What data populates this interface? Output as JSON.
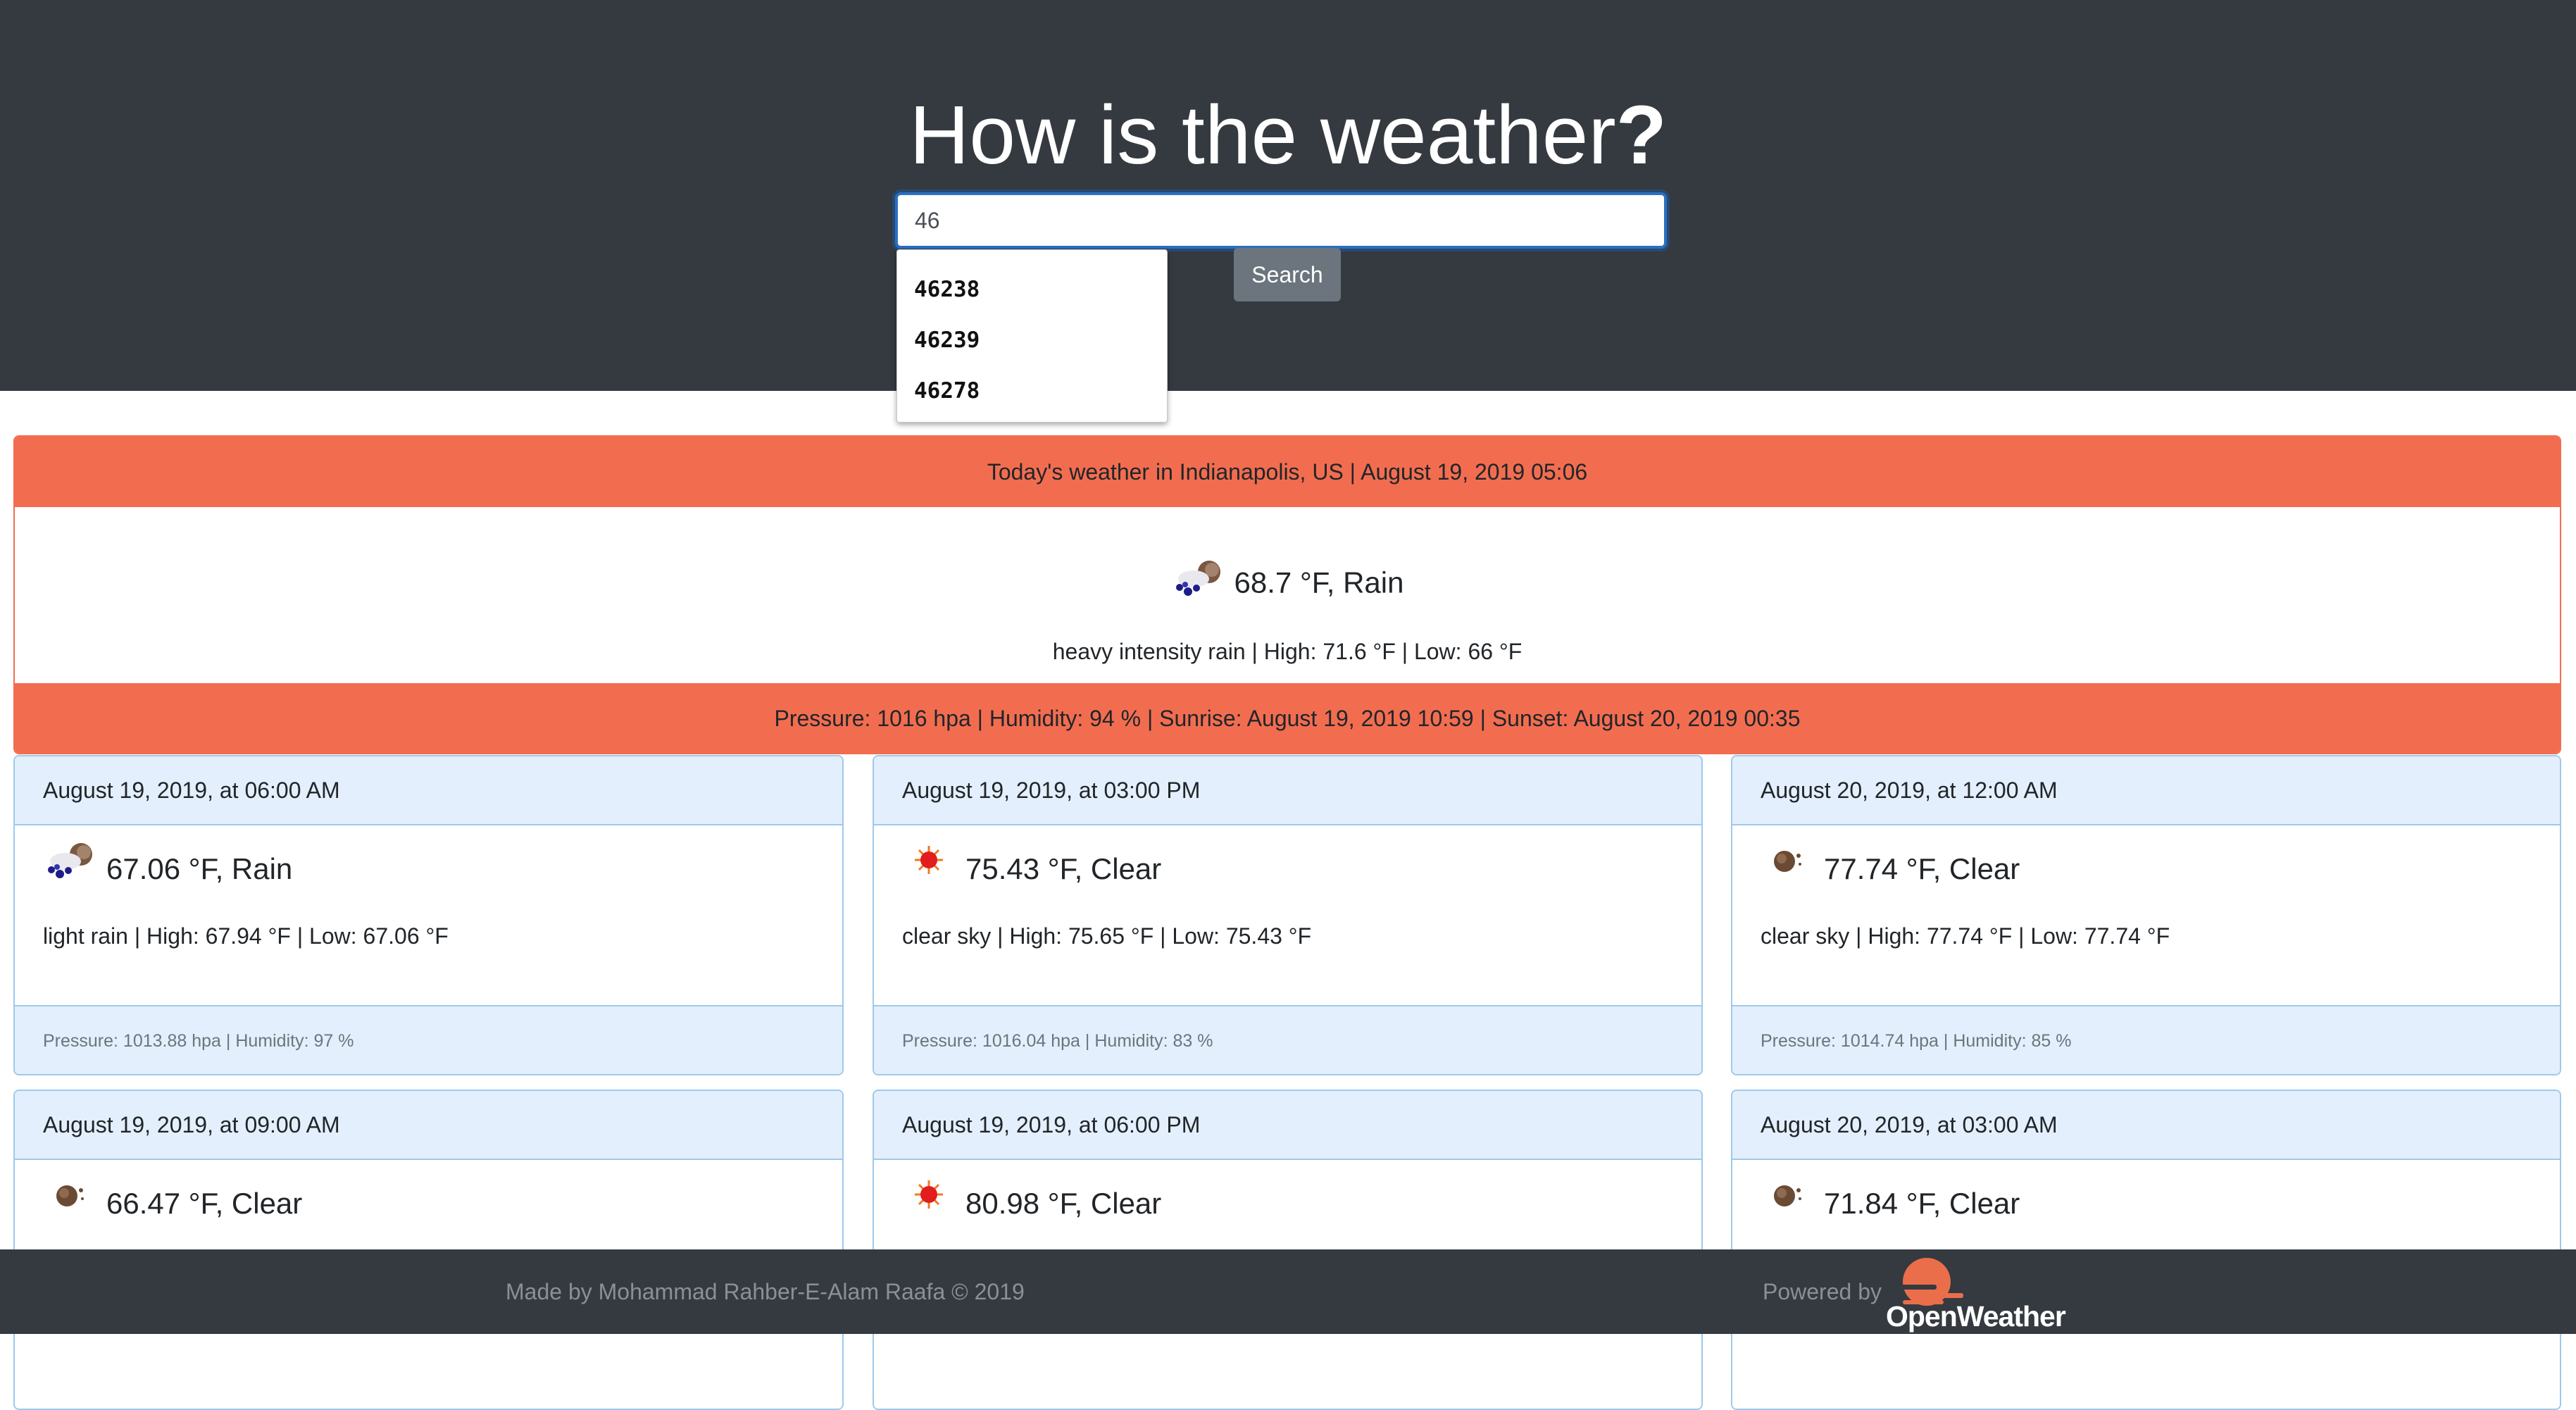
{
  "header": {
    "title": "How is the weather",
    "title_mark": "?",
    "search": {
      "value": "46",
      "button_label": "Search"
    },
    "autocomplete": [
      "46238",
      "46239",
      "46278"
    ]
  },
  "today": {
    "heading": "Today's weather in Indianapolis, US | August 19, 2019 05:06",
    "icon": "rain-cloud-icon",
    "summary": "68.7 °F, Rain",
    "detail": "heavy intensity rain | High: 71.6 °F | Low: 66 °F",
    "footer": "Pressure: 1016 hpa | Humidity: 94 % | Sunrise: August 19, 2019 10:59 | Sunset: August 20, 2019 00:35"
  },
  "forecast": [
    {
      "time": "August 19, 2019, at 06:00 AM",
      "icon": "rain-cloud-icon",
      "summary": "67.06 °F, Rain",
      "detail": "light rain | High: 67.94 °F | Low: 67.06 °F",
      "footer": "Pressure: 1013.88 hpa | Humidity: 97 %"
    },
    {
      "time": "August 19, 2019, at 03:00 PM",
      "icon": "sun-icon",
      "summary": "75.43 °F, Clear",
      "detail": "clear sky | High: 75.65 °F | Low: 75.43 °F",
      "footer": "Pressure: 1016.04 hpa | Humidity: 83 %"
    },
    {
      "time": "August 20, 2019, at 12:00 AM",
      "icon": "moon-icon",
      "summary": "77.74 °F, Clear",
      "detail": "clear sky | High: 77.74 °F | Low: 77.74 °F",
      "footer": "Pressure: 1014.74 hpa | Humidity: 85 %"
    },
    {
      "time": "August 19, 2019, at 09:00 AM",
      "icon": "moon-icon",
      "summary": "66.47 °F, Clear"
    },
    {
      "time": "August 19, 2019, at 06:00 PM",
      "icon": "sun-icon",
      "summary": "80.98 °F, Clear"
    },
    {
      "time": "August 20, 2019, at 03:00 AM",
      "icon": "moon-icon",
      "summary": "71.84 °F, Clear"
    }
  ],
  "footer": {
    "credit": "Made by Mohammad Rahber-E-Alam Raafa © 2019",
    "powered_by": "Powered by",
    "logo_text": "OpenWeather"
  },
  "colors": {
    "header_bg": "#343a40",
    "accent": "#f26d50",
    "card_header": "#e3effc",
    "card_border": "#9ec9ec",
    "button": "#6c757d"
  }
}
